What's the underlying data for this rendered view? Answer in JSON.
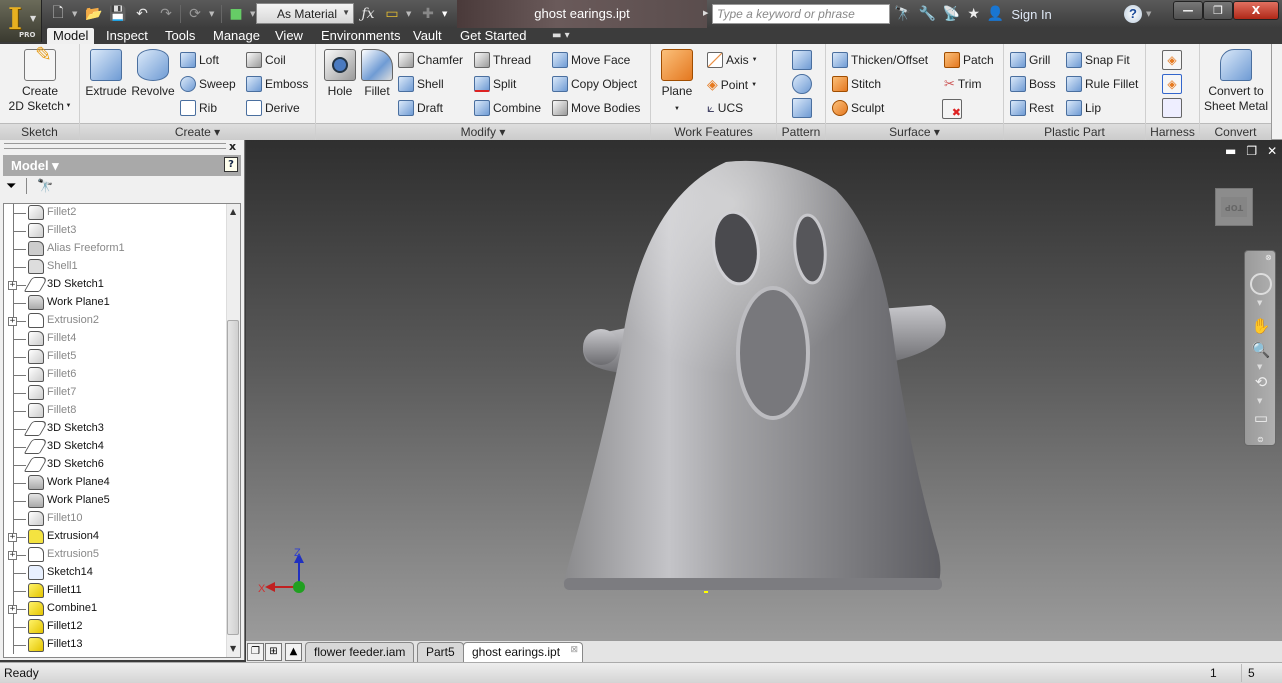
{
  "app": {
    "name": "Autodesk Inventor",
    "edition": "PRO",
    "logo_letter": "I"
  },
  "title_bar": {
    "document_title": "ghost earings.ipt",
    "appearance_dropdown": "As Material",
    "search_placeholder": "Type a keyword or phrase",
    "sign_in": "Sign In",
    "quick_access_icons": [
      "new-icon",
      "open-icon",
      "save-icon",
      "undo-icon",
      "redo-icon",
      "update-icon",
      "select-icon"
    ],
    "right_icons": [
      "binoculars-icon",
      "wrench-icon",
      "satellite-icon",
      "star-icon",
      "user-icon"
    ],
    "window_controls": {
      "minimize": "—",
      "restore": "❐",
      "close": "X"
    }
  },
  "ribbon_tabs": [
    {
      "label": "Model",
      "active": true
    },
    {
      "label": "Inspect"
    },
    {
      "label": "Tools"
    },
    {
      "label": "Manage"
    },
    {
      "label": "View"
    },
    {
      "label": "Environments"
    },
    {
      "label": "Vault"
    },
    {
      "label": "Get Started"
    }
  ],
  "ribbon": {
    "sketch": {
      "title": "Sketch",
      "create_2d_sketch": [
        "Create",
        "2D Sketch"
      ]
    },
    "create": {
      "title": "Create ▾",
      "extrude": "Extrude",
      "revolve": "Revolve",
      "small": [
        "Loft",
        "Sweep",
        "Rib",
        "Coil",
        "Emboss",
        "Derive"
      ]
    },
    "modify": {
      "title": "Modify ▾",
      "hole": "Hole",
      "fillet": "Fillet",
      "small": [
        "Chamfer",
        "Shell",
        "Draft",
        "Thread",
        "Split",
        "Combine",
        "Move Face",
        "Copy Object",
        "Move Bodies"
      ]
    },
    "work_features": {
      "title": "Work Features",
      "plane": "Plane",
      "small": [
        "Axis",
        "Point",
        "UCS"
      ]
    },
    "pattern": {
      "title": "Pattern"
    },
    "surface": {
      "title": "Surface ▾",
      "small": [
        "Thicken/Offset",
        "Stitch",
        "Sculpt",
        "Patch",
        "Trim"
      ]
    },
    "plastic_part": {
      "title": "Plastic Part",
      "small": [
        "Grill",
        "Boss",
        "Rest",
        "Snap Fit",
        "Rule Fillet",
        "Lip"
      ]
    },
    "harness": {
      "title": "Harness"
    },
    "convert": {
      "title": "Convert",
      "convert_to_sheet_metal": [
        "Convert to",
        "Sheet Metal"
      ]
    }
  },
  "browser": {
    "title": "Model ▾",
    "help": "?",
    "close": "x",
    "nodes": [
      {
        "label": "Fillet2",
        "icon": "fillet",
        "dim": true
      },
      {
        "label": "Fillet3",
        "icon": "fillet",
        "dim": true
      },
      {
        "label": "Alias Freeform1",
        "icon": "alias",
        "dim": true
      },
      {
        "label": "Shell1",
        "icon": "shell",
        "dim": true
      },
      {
        "label": "3D Sketch1",
        "icon": "sketch",
        "expandable": true
      },
      {
        "label": "Work Plane1",
        "icon": "plane"
      },
      {
        "label": "Extrusion2",
        "icon": "ext",
        "dim": true,
        "expandable": true
      },
      {
        "label": "Fillet4",
        "icon": "fillet",
        "dim": true
      },
      {
        "label": "Fillet5",
        "icon": "fillet",
        "dim": true
      },
      {
        "label": "Fillet6",
        "icon": "fillet",
        "dim": true
      },
      {
        "label": "Fillet7",
        "icon": "fillet",
        "dim": true
      },
      {
        "label": "Fillet8",
        "icon": "fillet",
        "dim": true
      },
      {
        "label": "3D Sketch3",
        "icon": "sketch"
      },
      {
        "label": "3D Sketch4",
        "icon": "sketch-y"
      },
      {
        "label": "3D Sketch6",
        "icon": "sketch"
      },
      {
        "label": "Work Plane4",
        "icon": "plane"
      },
      {
        "label": "Work Plane5",
        "icon": "plane"
      },
      {
        "label": "Fillet10",
        "icon": "fillet",
        "dim": true
      },
      {
        "label": "Extrusion4",
        "icon": "ext-y",
        "expandable": true
      },
      {
        "label": "Extrusion5",
        "icon": "ext",
        "dim": true,
        "expandable": true
      },
      {
        "label": "Sketch14",
        "icon": "sk2d"
      },
      {
        "label": "Fillet11",
        "icon": "fillet-y"
      },
      {
        "label": "Combine1",
        "icon": "fillet-y",
        "expandable": true
      },
      {
        "label": "Fillet12",
        "icon": "fillet-y"
      },
      {
        "label": "Fillet13",
        "icon": "fillet-y"
      }
    ]
  },
  "viewport": {
    "viewcube_label": "TOP",
    "triad": {
      "x": "X",
      "z": "Z"
    },
    "model": "ghost figure"
  },
  "doc_tabs": [
    {
      "label": "flower feeder.iam"
    },
    {
      "label": "Part5"
    },
    {
      "label": "ghost earings.ipt",
      "active": true
    }
  ],
  "status_bar": {
    "text": "Ready",
    "count1": "1",
    "count2": "5"
  }
}
